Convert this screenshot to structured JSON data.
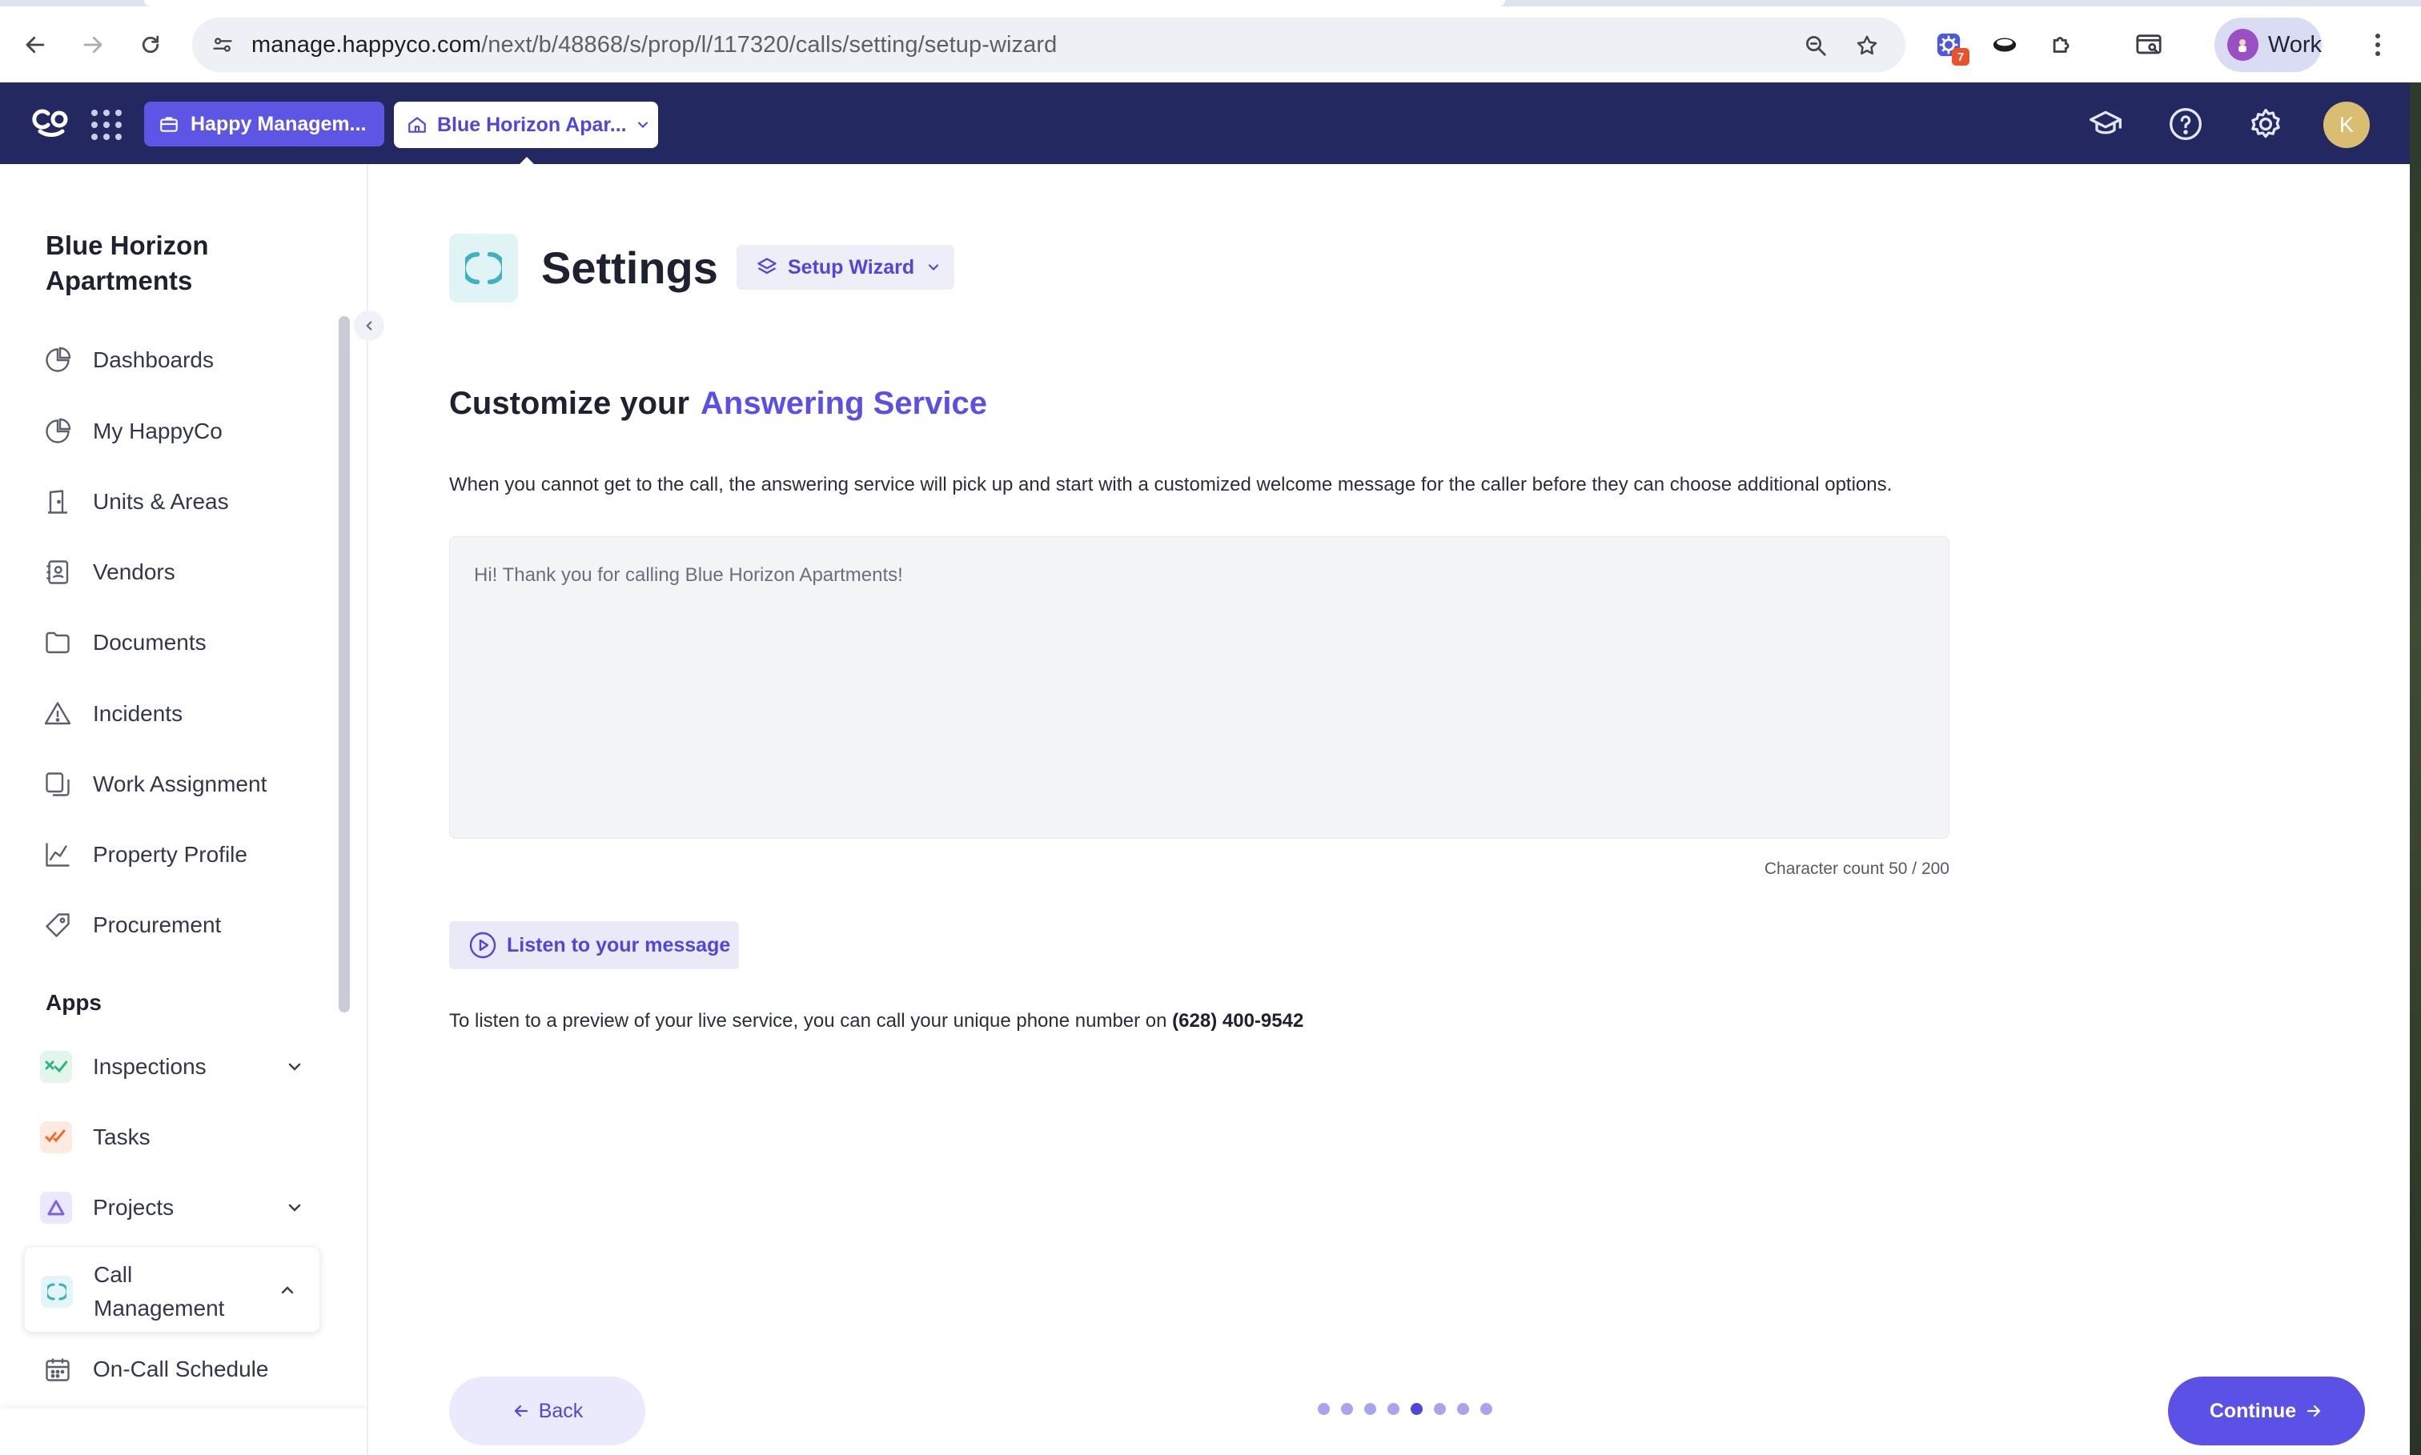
{
  "browser": {
    "url_host": "manage.happyco.com",
    "url_path": "/next/b/48868/s/prop/l/117320/calls/setting/setup-wizard",
    "extension_badge": "7",
    "profile_label": "Work"
  },
  "header": {
    "org_label": "Happy Managem...",
    "property_label": "Blue Horizon Apar...",
    "user_initial": "K"
  },
  "sidebar": {
    "title": "Blue Horizon Apartments",
    "items": [
      {
        "label": "Dashboards",
        "icon": "pie-chart-icon"
      },
      {
        "label": "My HappyCo",
        "icon": "pie-chart-icon"
      },
      {
        "label": "Units & Areas",
        "icon": "door-icon"
      },
      {
        "label": "Vendors",
        "icon": "contact-book-icon"
      },
      {
        "label": "Documents",
        "icon": "folder-icon"
      },
      {
        "label": "Incidents",
        "icon": "warning-icon"
      },
      {
        "label": "Work Assignment",
        "icon": "notes-icon"
      },
      {
        "label": "Property Profile",
        "icon": "line-chart-icon"
      },
      {
        "label": "Procurement",
        "icon": "tag-icon"
      }
    ],
    "apps_heading": "Apps",
    "apps": [
      {
        "label": "Inspections",
        "icon": "inspections-icon",
        "color": "#2fb67c"
      },
      {
        "label": "Tasks",
        "icon": "tasks-icon",
        "color": "#f06a2a"
      },
      {
        "label": "Projects",
        "icon": "projects-icon",
        "color": "#7b63e0"
      }
    ],
    "call_management": {
      "label": "Call Management",
      "icon": "call-management-icon",
      "color": "#3fb1c2"
    },
    "sub_items": [
      {
        "label": "On-Call Schedule",
        "icon": "calendar-icon"
      }
    ]
  },
  "main": {
    "page_title": "Settings",
    "wizard_label": "Setup Wizard",
    "heading_prefix": "Customize your",
    "heading_accent": "Answering Service",
    "description": "When you cannot get to the call, the answering service will pick up and start with a customized welcome message for the caller before they can choose additional options.",
    "message_value": "Hi! Thank you for calling Blue Horizon Apartments!",
    "char_count_label": "Character count 50 / 200",
    "listen_label": "Listen to your message",
    "preview_text": "To listen to a preview of your live service, you can call your unique phone number on",
    "phone_number": "(628) 400-9542",
    "back_label": "Back",
    "continue_label": "Continue",
    "steps_total": 8,
    "current_step": 5
  },
  "colors": {
    "header_bg": "#232860",
    "accent": "#5a50e6",
    "call_mgmt_teal": "#3fb1c2"
  }
}
